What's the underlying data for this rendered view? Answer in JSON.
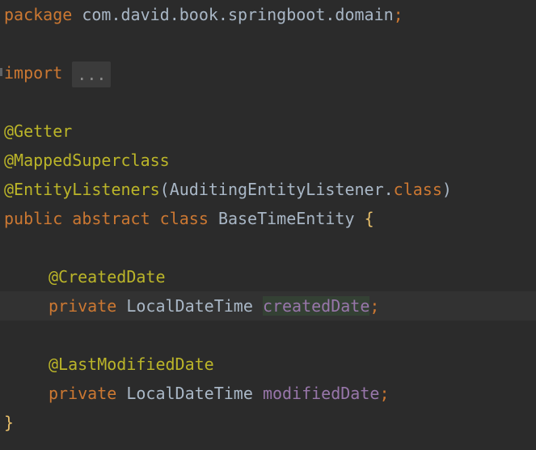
{
  "colors": {
    "background": "#2b2b2b",
    "keyword": "#cc7832",
    "annotation": "#bbb529",
    "field": "#9876aa",
    "text": "#a9b7c6"
  },
  "code": {
    "package_kw": "package",
    "package_name": "com.david.book.springboot.domain",
    "semicolon": ";",
    "import_kw": "import",
    "import_fold": "...",
    "ann_getter": "@Getter",
    "ann_mapped": "@MappedSuperclass",
    "ann_entity_listeners": "@EntityListeners",
    "paren_open": "(",
    "listener_class": "AuditingEntityListener",
    "dot": ".",
    "class_kw_literal": "class",
    "paren_close": ")",
    "public_kw": "public",
    "abstract_kw": "abstract",
    "class_kw": "class",
    "class_name": "BaseTimeEntity",
    "brace_open": "{",
    "ann_created": "@CreatedDate",
    "private_kw": "private",
    "type_ldt": "LocalDateTime",
    "field_created": "createdDate",
    "ann_modified": "@LastModifiedDate",
    "field_modified": "modifiedDate",
    "brace_close": "}"
  }
}
